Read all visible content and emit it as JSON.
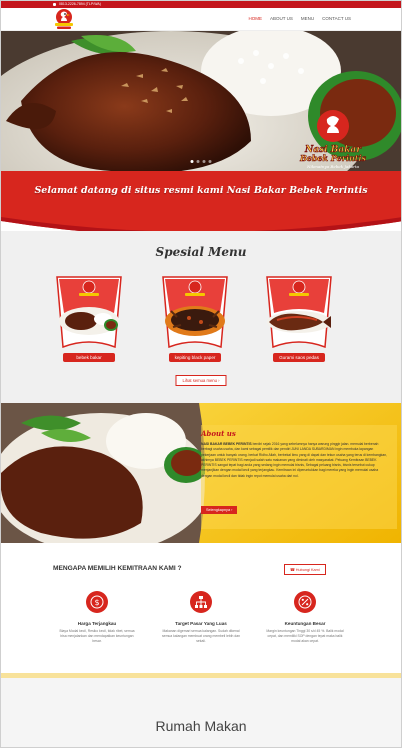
{
  "topbar": {
    "phone": "0813-2226-7894 (TLP/WA)"
  },
  "header": {
    "logo": "nasi-bakar-bebek-perintis-logo"
  },
  "nav": {
    "items": [
      "HOME",
      "ABOUT US",
      "MENU",
      "CONTACT US"
    ],
    "active": "HOME"
  },
  "hero": {
    "brand_line1": "Nasi Bakar",
    "brand_line2": "Bebek Perintis",
    "tagline": "Nikmatnya Bebek Jakarta",
    "slide_count": 4,
    "active_slide": 1
  },
  "welcome": {
    "text": "Selamat datang di situs resmi kami Nasi Bakar Bebek Perintis"
  },
  "menu": {
    "title": "Spesial Menu",
    "items": [
      {
        "label": "bebek bakar"
      },
      {
        "label": "kepiting black paper"
      },
      {
        "label": "Gurami saos pedas"
      }
    ],
    "see_all": "Lihat semua menu"
  },
  "about": {
    "title": "About us",
    "brand": "NASI BAKAR BEBEK PERINTIS",
    "body": "berdiri sejak 2016 yang sebelumnya hanya warung pinggir jalan. memulai berbenah berbagi usaha usaha, dan kami sebagai pemilik dan pendiri JUNI LANDA SUBARDIMAN ingin membuka lapangan pekerjaan untuk banyak orang. berkat Ridho Allah, berbekal ilmu yang di dapat dan tekun usaha yang terus di kembangkan, akhirnya BEBEK PERINTIS menjadi salah satu makanan yang diminati oleh masyarakat. Peluang Kemitraan BEBEK PERINTIS sangat tepat bagi anda yang sedang ingin memulai bisnis, Sebagai peluang bisnis, bisnis tersebut cukup menjanjikan dengan modal kecil yang terjangkau. Kemitraan ini diperuntukkan bagi mereka yang ingin memulai usaha dengan modal kecil dan tidak ingin repot memulai usaha dari nol.",
    "button": "Selengkapnya"
  },
  "why": {
    "title": "MENGAPA MEMILIH KEMITRAAN KAMI ?",
    "button": "Hubungi Kami",
    "features": [
      {
        "title": "Harga Terjangkau",
        "desc": "Biaya Modal kecil, Resiko kecil, tidak ribet, semua bisa menjalankan dan mendapatkan keuntungan besar."
      },
      {
        "title": "Target Pasar Yang Luas",
        "desc": "Makanan digemari semua kalangan. Sudah dikenal semua kalangan membuat orang membeli lebih dan sekali."
      },
      {
        "title": "Keuntungan Besar",
        "desc": "Margin keuntungan Tinggi 30 s/d 45 %. Balik modal cepat, dan memiliki SOP dengan tepat maka balik modal akan cepat."
      }
    ]
  },
  "footer_section": {
    "title": "Rumah Makan"
  },
  "colors": {
    "primary": "#d7261e",
    "accent": "#f5c800",
    "dark": "#333333"
  }
}
